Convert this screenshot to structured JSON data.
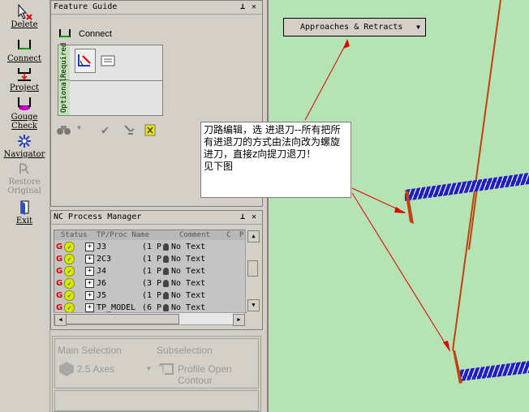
{
  "toolbar": {
    "delete": "Delete",
    "connect": "Connect",
    "project": "Project",
    "gouge_line1": "Gouge",
    "gouge_line2": "Check",
    "navigator": "Navigator",
    "restore_line1": "Restore",
    "restore_line2": "Original",
    "exit": "Exit"
  },
  "feature_guide": {
    "title": "Feature Guide",
    "connect_label": "Connect",
    "required_tab": "Required",
    "optional_tab": "Optional"
  },
  "nc_manager": {
    "title": "NC Process Manager",
    "columns": [
      "Status",
      "TP/Proc Name",
      "Comment",
      "C",
      "P"
    ],
    "rows": [
      {
        "name": "J3",
        "count": "(1 P",
        "comment": "No Text"
      },
      {
        "name": "2C3",
        "count": "(1 P",
        "comment": "No Text"
      },
      {
        "name": "J4",
        "count": "(1 P",
        "comment": "No Text"
      },
      {
        "name": "J6",
        "count": "(3 P",
        "comment": "No Text"
      },
      {
        "name": "J5",
        "count": "(1 P",
        "comment": "No Text"
      },
      {
        "name": "TP_MODEL",
        "count": "(6 P",
        "comment": "No Text"
      }
    ]
  },
  "selection": {
    "main_label": "Main Selection",
    "sub_label": "Subselection",
    "main_value": "2.5 Axes",
    "sub_value": "Profile Open Contour"
  },
  "canvas": {
    "dropdown_label": "Approaches & Retracts",
    "callout_text": "刀路编辑，选 进退刀--所有把所有进退刀的方式由法向改为螺旋进刀，直接z向提刀退刀！\n见下图"
  },
  "colors": {
    "canvas_bg": "#b5e3b4",
    "toolpath": "#c04010",
    "helix": "#2020c0",
    "arrow": "#e00000"
  }
}
